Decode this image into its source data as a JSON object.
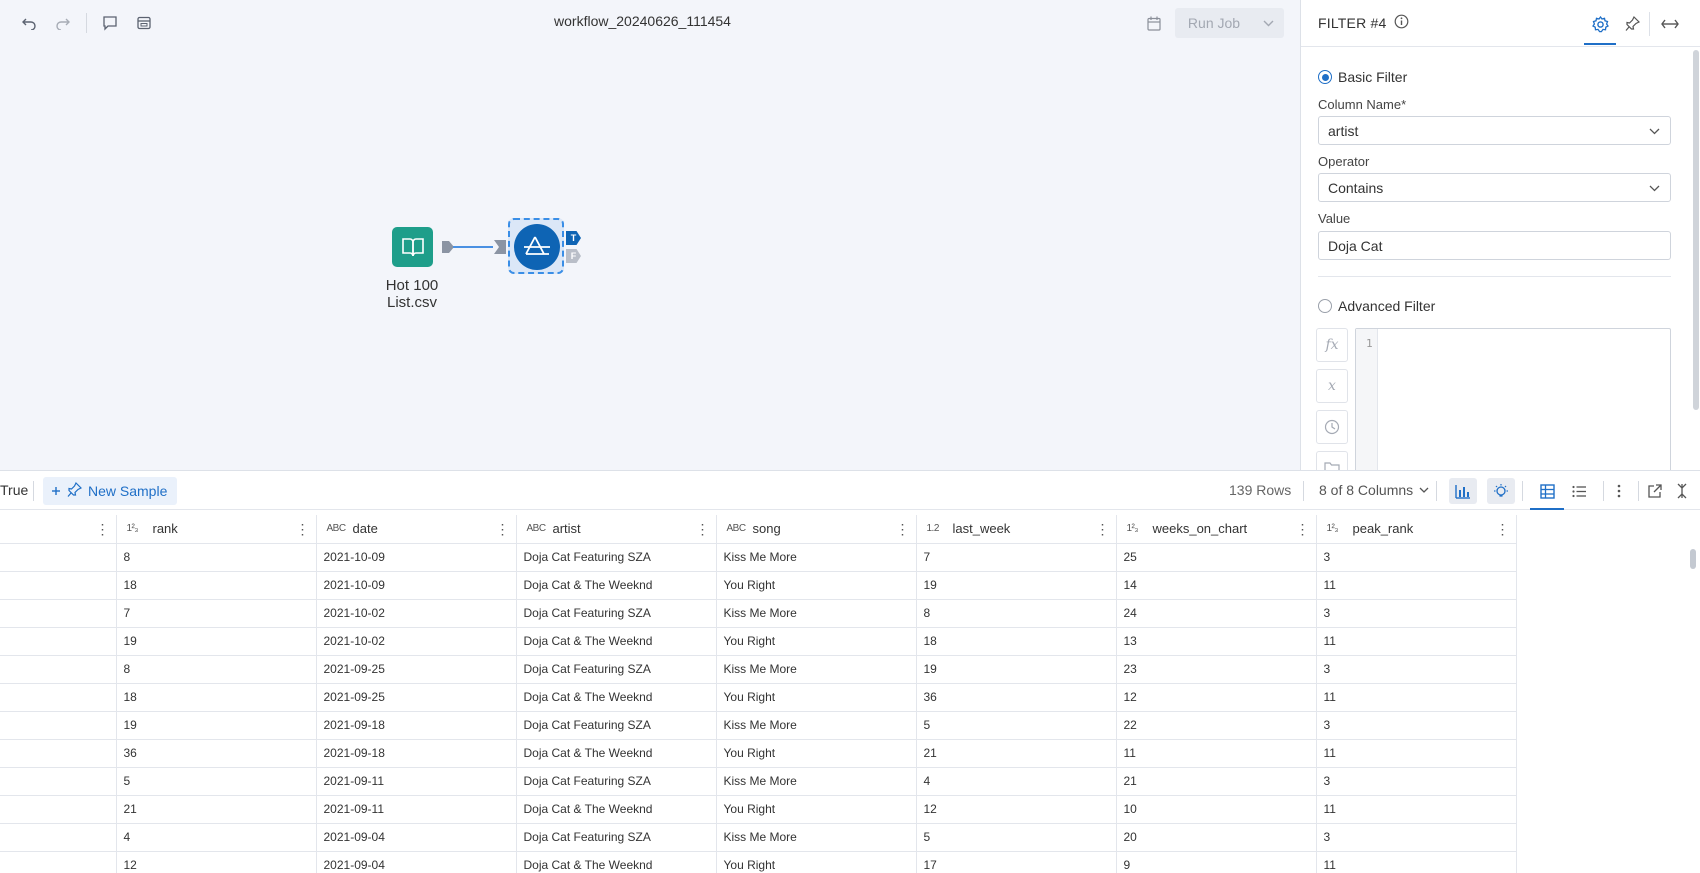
{
  "workflow": {
    "title": "workflow_20240626_111454"
  },
  "toolbar": {
    "undo_icon": "undo-icon",
    "redo_icon": "redo-icon",
    "comment_icon": "comment-icon",
    "tool_icon": "container-icon"
  },
  "run_job": {
    "label": "Run Job"
  },
  "nodes": {
    "input": {
      "label_line1": "Hot 100",
      "label_line2": "List.csv"
    },
    "filter": {
      "true_anchor": "T",
      "false_anchor": "F"
    }
  },
  "panel": {
    "title": "FILTER #4",
    "basic_filter_label": "Basic Filter",
    "column_name_label": "Column Name*",
    "column_name_value": "artist",
    "operator_label": "Operator",
    "operator_value": "Contains",
    "value_label": "Value",
    "value_value": "Doja Cat",
    "advanced_filter_label": "Advanced Filter",
    "editor_line": "1",
    "fx_label": "fx",
    "x_label": "x"
  },
  "grid_toolbar": {
    "true_label": "True",
    "new_sample_label": "New Sample",
    "rows": "139 Rows",
    "columns": "8 of 8 Columns"
  },
  "table": {
    "columns": [
      {
        "type": "",
        "name": ""
      },
      {
        "type": "1²₃",
        "name": "rank"
      },
      {
        "type": "ABC",
        "name": "date"
      },
      {
        "type": "ABC",
        "name": "artist"
      },
      {
        "type": "ABC",
        "name": "song"
      },
      {
        "type": "1.2",
        "name": "last_week"
      },
      {
        "type": "1²₃",
        "name": "weeks_on_chart"
      },
      {
        "type": "1²₃",
        "name": "peak_rank"
      }
    ],
    "rows": [
      [
        "",
        "8",
        "2021-10-09",
        "Doja Cat Featuring SZA",
        "Kiss Me More",
        "7",
        "25",
        "3"
      ],
      [
        "",
        "18",
        "2021-10-09",
        "Doja Cat & The Weeknd",
        "You Right",
        "19",
        "14",
        "11"
      ],
      [
        "",
        "7",
        "2021-10-02",
        "Doja Cat Featuring SZA",
        "Kiss Me More",
        "8",
        "24",
        "3"
      ],
      [
        "",
        "19",
        "2021-10-02",
        "Doja Cat & The Weeknd",
        "You Right",
        "18",
        "13",
        "11"
      ],
      [
        "",
        "8",
        "2021-09-25",
        "Doja Cat Featuring SZA",
        "Kiss Me More",
        "19",
        "23",
        "3"
      ],
      [
        "",
        "18",
        "2021-09-25",
        "Doja Cat & The Weeknd",
        "You Right",
        "36",
        "12",
        "11"
      ],
      [
        "",
        "19",
        "2021-09-18",
        "Doja Cat Featuring SZA",
        "Kiss Me More",
        "5",
        "22",
        "3"
      ],
      [
        "",
        "36",
        "2021-09-18",
        "Doja Cat & The Weeknd",
        "You Right",
        "21",
        "11",
        "11"
      ],
      [
        "",
        "5",
        "2021-09-11",
        "Doja Cat Featuring SZA",
        "Kiss Me More",
        "4",
        "21",
        "3"
      ],
      [
        "",
        "21",
        "2021-09-11",
        "Doja Cat & The Weeknd",
        "You Right",
        "12",
        "10",
        "11"
      ],
      [
        "",
        "4",
        "2021-09-04",
        "Doja Cat Featuring SZA",
        "Kiss Me More",
        "5",
        "20",
        "3"
      ],
      [
        "",
        "12",
        "2021-09-04",
        "Doja Cat & The Weeknd",
        "You Right",
        "17",
        "9",
        "11"
      ]
    ]
  }
}
